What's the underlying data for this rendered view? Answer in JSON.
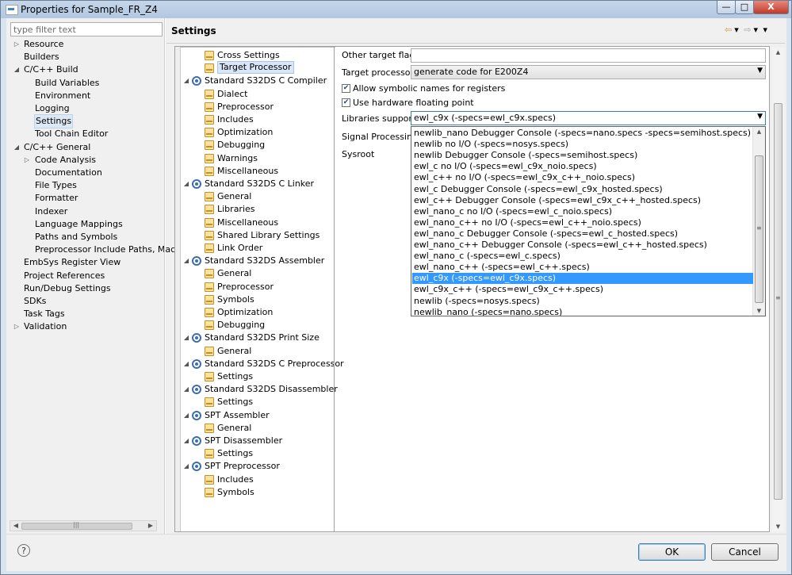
{
  "window": {
    "title": "Properties for Sample_FR_Z4",
    "minimize": "—",
    "maximize": "□",
    "close": "X"
  },
  "nav": {
    "filter_placeholder": "type filter text",
    "items": [
      {
        "label": "Resource",
        "twisty": "▷"
      },
      {
        "label": "Builders",
        "twisty": ""
      },
      {
        "label": "C/C++ Build",
        "twisty": "◢"
      },
      {
        "label": "Build Variables",
        "twisty": ""
      },
      {
        "label": "Environment",
        "twisty": ""
      },
      {
        "label": "Logging",
        "twisty": ""
      },
      {
        "label": "Settings",
        "twisty": ""
      },
      {
        "label": "Tool Chain Editor",
        "twisty": ""
      },
      {
        "label": "C/C++ General",
        "twisty": "◢"
      },
      {
        "label": "Code Analysis",
        "twisty": "▷"
      },
      {
        "label": "Documentation",
        "twisty": ""
      },
      {
        "label": "File Types",
        "twisty": ""
      },
      {
        "label": "Formatter",
        "twisty": ""
      },
      {
        "label": "Indexer",
        "twisty": ""
      },
      {
        "label": "Language Mappings",
        "twisty": ""
      },
      {
        "label": "Paths and Symbols",
        "twisty": ""
      },
      {
        "label": "Preprocessor Include Paths, Macros",
        "twisty": ""
      },
      {
        "label": "EmbSys Register View",
        "twisty": ""
      },
      {
        "label": "Project References",
        "twisty": ""
      },
      {
        "label": "Run/Debug Settings",
        "twisty": ""
      },
      {
        "label": "SDKs",
        "twisty": ""
      },
      {
        "label": "Task Tags",
        "twisty": ""
      },
      {
        "label": "Validation",
        "twisty": "▷"
      }
    ],
    "scroll_left": "◀",
    "scroll_right": "▶",
    "scroll_grip": "|||"
  },
  "page": {
    "title": "Settings",
    "back": "⇦",
    "back_dd": "▾",
    "forward": "⇨",
    "forward_dd": "▾",
    "menu": "▾"
  },
  "tool_tree": [
    {
      "label": "Cross Settings",
      "icon": "folder-settings",
      "twisty": ""
    },
    {
      "label": "Target Processor",
      "icon": "folder-settings",
      "twisty": ""
    },
    {
      "label": "Standard S32DS C Compiler",
      "icon": "tool-gear",
      "twisty": "◢"
    },
    {
      "label": "Dialect",
      "icon": "folder-settings",
      "twisty": ""
    },
    {
      "label": "Preprocessor",
      "icon": "folder-settings",
      "twisty": ""
    },
    {
      "label": "Includes",
      "icon": "folder-settings",
      "twisty": ""
    },
    {
      "label": "Optimization",
      "icon": "folder-settings",
      "twisty": ""
    },
    {
      "label": "Debugging",
      "icon": "folder-settings",
      "twisty": ""
    },
    {
      "label": "Warnings",
      "icon": "folder-settings",
      "twisty": ""
    },
    {
      "label": "Miscellaneous",
      "icon": "folder-settings",
      "twisty": ""
    },
    {
      "label": "Standard S32DS C Linker",
      "icon": "tool-gear",
      "twisty": "◢"
    },
    {
      "label": "General",
      "icon": "folder-settings",
      "twisty": ""
    },
    {
      "label": "Libraries",
      "icon": "folder-settings",
      "twisty": ""
    },
    {
      "label": "Miscellaneous",
      "icon": "folder-settings",
      "twisty": ""
    },
    {
      "label": "Shared Library Settings",
      "icon": "folder-settings",
      "twisty": ""
    },
    {
      "label": "Link Order",
      "icon": "folder-settings",
      "twisty": ""
    },
    {
      "label": "Standard S32DS Assembler",
      "icon": "tool-gear",
      "twisty": "◢"
    },
    {
      "label": "General",
      "icon": "folder-settings",
      "twisty": ""
    },
    {
      "label": "Preprocessor",
      "icon": "folder-settings",
      "twisty": ""
    },
    {
      "label": "Symbols",
      "icon": "folder-settings",
      "twisty": ""
    },
    {
      "label": "Optimization",
      "icon": "folder-settings",
      "twisty": ""
    },
    {
      "label": "Debugging",
      "icon": "folder-settings",
      "twisty": ""
    },
    {
      "label": "Standard S32DS Print Size",
      "icon": "tool-gear",
      "twisty": "◢"
    },
    {
      "label": "General",
      "icon": "folder-settings",
      "twisty": ""
    },
    {
      "label": "Standard S32DS C Preprocessor",
      "icon": "tool-gear",
      "twisty": "◢"
    },
    {
      "label": "Settings",
      "icon": "folder-settings",
      "twisty": ""
    },
    {
      "label": "Standard S32DS Disassembler",
      "icon": "tool-gear",
      "twisty": "◢"
    },
    {
      "label": "Settings",
      "icon": "folder-settings",
      "twisty": ""
    },
    {
      "label": "SPT Assembler",
      "icon": "tool-gear",
      "twisty": "◢"
    },
    {
      "label": "General",
      "icon": "folder-settings",
      "twisty": ""
    },
    {
      "label": "SPT Disassembler",
      "icon": "tool-gear",
      "twisty": "◢"
    },
    {
      "label": "Settings",
      "icon": "folder-settings",
      "twisty": ""
    },
    {
      "label": "SPT Preprocessor",
      "icon": "tool-gear",
      "twisty": "◢"
    },
    {
      "label": "Includes",
      "icon": "folder-settings",
      "twisty": ""
    },
    {
      "label": "Symbols",
      "icon": "folder-settings",
      "twisty": ""
    }
  ],
  "form": {
    "other_flags_label": "Other target flags",
    "other_flags_value": "",
    "target_processor_label": "Target processor",
    "target_processor_value": "generate code for E200Z4",
    "allow_symbolic_label": "Allow symbolic names for registers",
    "allow_symbolic_checked": "✔",
    "hw_float_label": "Use hardware floating point",
    "hw_float_checked": "✔",
    "libraries_label": "Libraries support",
    "libraries_value": "ewl_c9x (-specs=ewl_c9x.specs)",
    "signal_label": "Signal Processing",
    "sysroot_label": "Sysroot",
    "combo_arrow": "▼"
  },
  "dropdown": {
    "options": [
      "newlib_nano Debugger Console (-specs=nano.specs -specs=semihost.specs)",
      "newlib no I/O (-specs=nosys.specs)",
      "newlib Debugger Console (-specs=semihost.specs)",
      "ewl_c no I/O (-specs=ewl_c9x_noio.specs)",
      "ewl_c++ no I/O (-specs=ewl_c9x_c++_noio.specs)",
      "ewl_c Debugger Console (-specs=ewl_c9x_hosted.specs)",
      "ewl_c++ Debugger Console (-specs=ewl_c9x_c++_hosted.specs)",
      "ewl_nano_c no I/O (-specs=ewl_c_noio.specs)",
      "ewl_nano_c++ no I/O (-specs=ewl_c++_noio.specs)",
      "ewl_nano_c Debugger Console (-specs=ewl_c_hosted.specs)",
      "ewl_nano_c++ Debugger Console (-specs=ewl_c++_hosted.specs)",
      "ewl_nano_c (-specs=ewl_c.specs)",
      "ewl_nano_c++ (-specs=ewl_c++.specs)",
      "ewl_c9x (-specs=ewl_c9x.specs)",
      "ewl_c9x_c++ (-specs=ewl_c9x_c++.specs)",
      "newlib (-specs=nosys.specs)",
      "newlib_nano (-specs=nano.specs)"
    ],
    "selected_index": 13,
    "scroll_up": "▲",
    "scroll_down": "▼",
    "scroll_grip": "≡"
  },
  "right_scroll": {
    "up": "▲",
    "down": "▼",
    "grip": "≡"
  },
  "footer": {
    "help": "?",
    "ok": "OK",
    "cancel": "Cancel"
  }
}
